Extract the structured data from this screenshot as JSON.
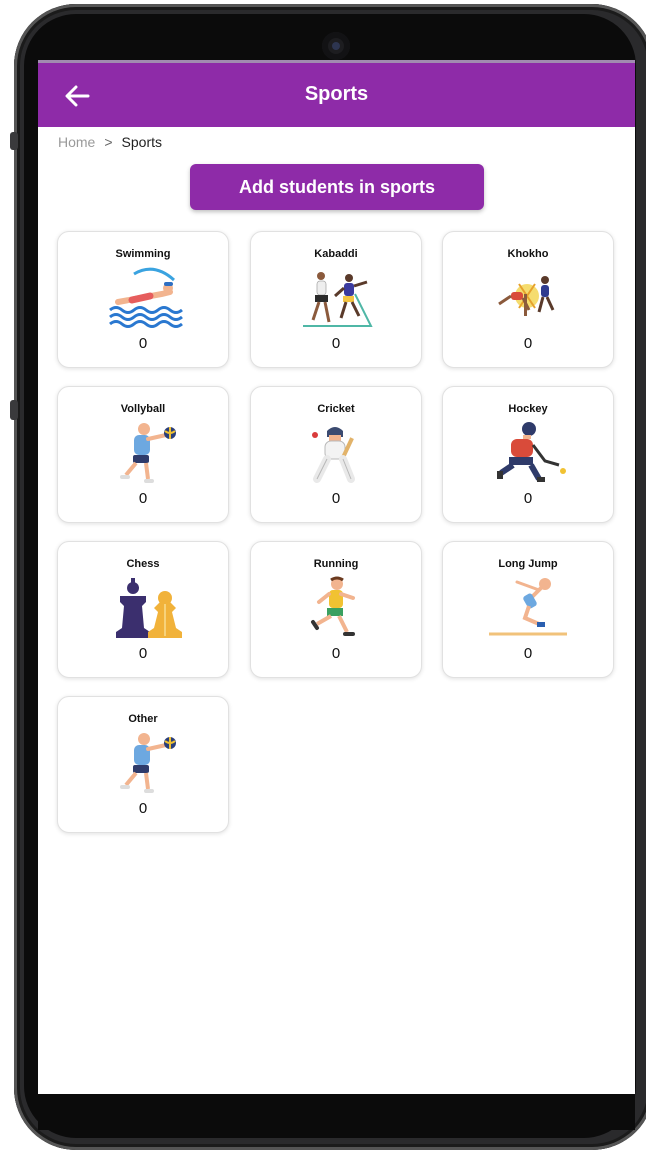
{
  "app": {
    "title": "Sports",
    "back_icon": "arrow-left-icon",
    "accent_color": "#8e2ba8"
  },
  "breadcrumb": {
    "home": "Home",
    "separator": ">",
    "current": "Sports"
  },
  "actions": {
    "add_label": "Add students in sports"
  },
  "sports": [
    {
      "name": "Swimming",
      "count": "0",
      "icon": "swimmer-icon"
    },
    {
      "name": "Kabaddi",
      "count": "0",
      "icon": "kabaddi-players-icon"
    },
    {
      "name": "Khokho",
      "count": "0",
      "icon": "khokho-players-icon"
    },
    {
      "name": "Vollyball",
      "count": "0",
      "icon": "volleyball-player-icon"
    },
    {
      "name": "Cricket",
      "count": "0",
      "icon": "cricket-batsman-icon"
    },
    {
      "name": "Hockey",
      "count": "0",
      "icon": "hockey-player-icon"
    },
    {
      "name": "Chess",
      "count": "0",
      "icon": "chess-pieces-icon"
    },
    {
      "name": "Running",
      "count": "0",
      "icon": "runner-icon"
    },
    {
      "name": "Long Jump",
      "count": "0",
      "icon": "long-jumper-icon"
    },
    {
      "name": "Other",
      "count": "0",
      "icon": "volleyball-player-icon"
    }
  ]
}
